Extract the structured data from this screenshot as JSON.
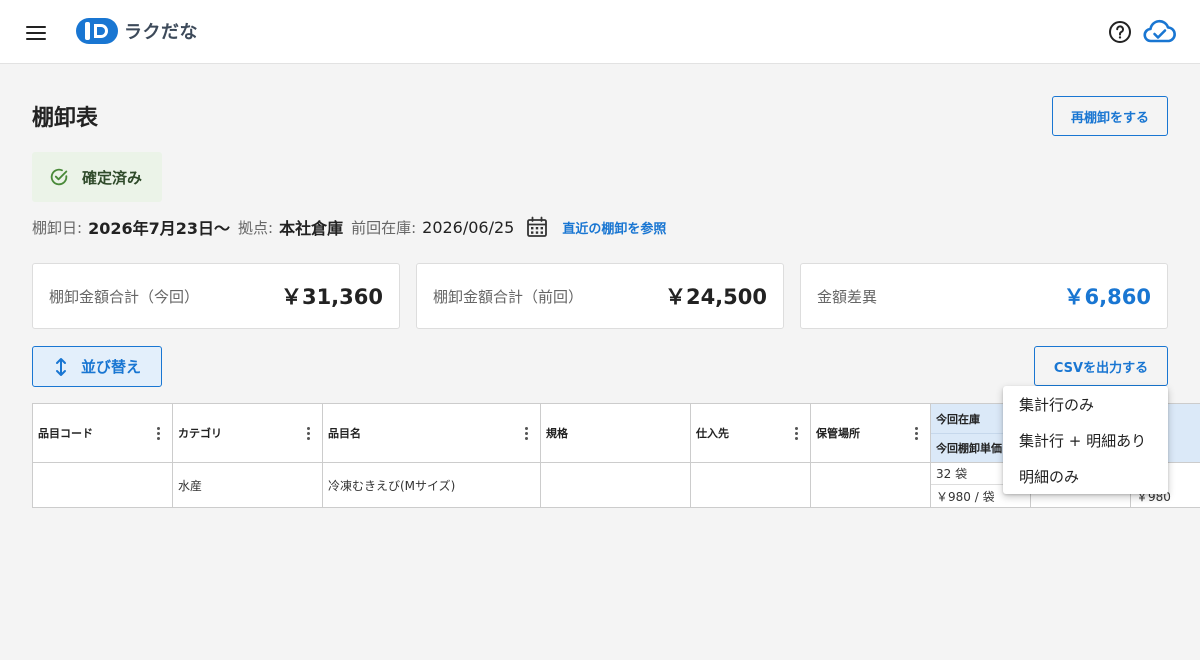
{
  "header": {
    "logo_text": "ラクだな",
    "brand_color": "#1976d2"
  },
  "page": {
    "title": "棚卸表",
    "recount_button": "再棚卸をする"
  },
  "status": {
    "label": "確定済み",
    "color": "#4a8a3a"
  },
  "info": {
    "date_label": "棚卸日:",
    "date_value": "2026年7月23日〜",
    "location_label": "拠点:",
    "location_value": "本社倉庫",
    "previous_label": "前回在庫:",
    "previous_value": "2026/06/25",
    "reference_link": "直近の棚卸を参照"
  },
  "summary": [
    {
      "label": "棚卸金額合計（今回）",
      "value": "￥31,360"
    },
    {
      "label": "棚卸金額合計（前回）",
      "value": "￥24,500"
    },
    {
      "label": "金額差異",
      "value": "￥6,860"
    }
  ],
  "toolbar": {
    "sort_label": "並び替え",
    "csv_label": "CSVを出力する"
  },
  "table": {
    "columns": [
      "品目コード",
      "カテゴリ",
      "品目名",
      "規格",
      "仕入先",
      "保管場所"
    ],
    "stock_header_top": "今回在庫",
    "stock_header_bottom": "今回棚卸単価",
    "rows": [
      {
        "code": "",
        "category": "水産",
        "name": "冷凍むきえび(Mサイズ)",
        "spec": "",
        "supplier": "",
        "storage": "",
        "quantity": "32 袋",
        "unit_price": "￥980 / 袋",
        "partial_price": "￥980"
      }
    ]
  },
  "csv_menu": {
    "items": [
      "集計行のみ",
      "集計行 + 明細あり",
      "明細のみ"
    ]
  }
}
